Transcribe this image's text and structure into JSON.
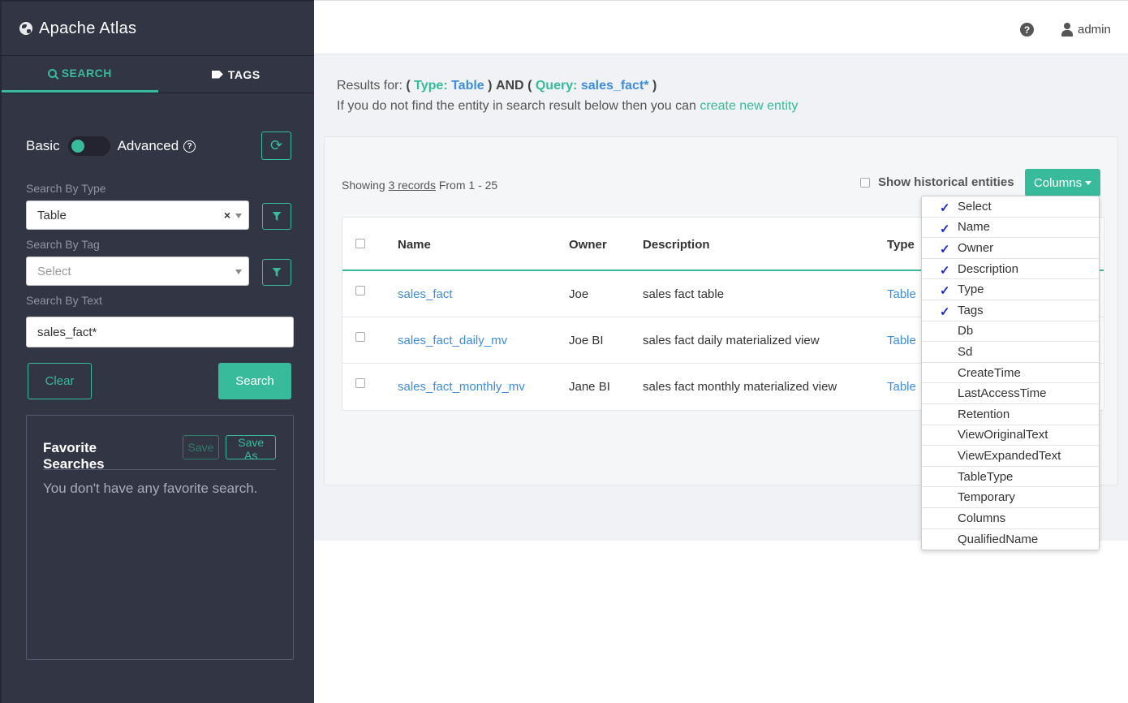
{
  "app": {
    "title": "Apache Atlas"
  },
  "sidebar": {
    "tabs": [
      {
        "label": "SEARCH",
        "active": true
      },
      {
        "label": "TAGS",
        "active": false
      }
    ],
    "toggle": {
      "basic_label": "Basic",
      "advanced_label": "Advanced",
      "advanced_help": "?"
    },
    "search_by_type": {
      "label": "Search By Type",
      "value": "Table",
      "clear": "×"
    },
    "search_by_tag": {
      "label": "Search By Tag",
      "placeholder": "Select"
    },
    "search_by_text": {
      "label": "Search By Text",
      "value": "sales_fact*"
    },
    "buttons": {
      "clear": "Clear",
      "search": "Search"
    },
    "favorites": {
      "title": "Favorite Searches",
      "save": "Save",
      "save_as": "Save As",
      "empty": "You don't have any favorite search."
    }
  },
  "header": {
    "help": "?",
    "user": "admin"
  },
  "main": {
    "results": {
      "prefix": "Results for:",
      "open1": "(",
      "type_kw": "Type:",
      "type_val": "Table",
      "close1": ")",
      "and": "AND",
      "open2": "(",
      "query_kw": "Query:",
      "query_val": "sales_fact*",
      "close2": ")"
    },
    "info": {
      "text": "If you do not find the entity in search result below then you can",
      "link": "create new entity"
    },
    "showing": {
      "prefix": "Showing",
      "count": "3 records",
      "suffix": "From 1 - 25"
    },
    "historical_label": "Show historical entities",
    "columns_button": "Columns",
    "table": {
      "headers": [
        "Name",
        "Owner",
        "Description",
        "Type"
      ],
      "rows": [
        {
          "name": "sales_fact",
          "owner": "Joe",
          "description": "sales fact table",
          "type": "Table"
        },
        {
          "name": "sales_fact_daily_mv",
          "owner": "Joe BI",
          "description": "sales fact daily materialized view",
          "type": "Table"
        },
        {
          "name": "sales_fact_monthly_mv",
          "owner": "Jane BI",
          "description": "sales fact monthly materialized view",
          "type": "Table"
        }
      ]
    },
    "columns_menu": [
      {
        "label": "Select",
        "checked": true
      },
      {
        "label": "Name",
        "checked": true
      },
      {
        "label": "Owner",
        "checked": true
      },
      {
        "label": "Description",
        "checked": true
      },
      {
        "label": "Type",
        "checked": true
      },
      {
        "label": "Tags",
        "checked": true
      },
      {
        "label": "Db",
        "checked": false
      },
      {
        "label": "Sd",
        "checked": false
      },
      {
        "label": "CreateTime",
        "checked": false
      },
      {
        "label": "LastAccessTime",
        "checked": false
      },
      {
        "label": "Retention",
        "checked": false
      },
      {
        "label": "ViewOriginalText",
        "checked": false
      },
      {
        "label": "ViewExpandedText",
        "checked": false
      },
      {
        "label": "TableType",
        "checked": false
      },
      {
        "label": "Temporary",
        "checked": false
      },
      {
        "label": "Columns",
        "checked": false
      },
      {
        "label": "QualifiedName",
        "checked": false
      }
    ],
    "check_glyph": "✓"
  },
  "colors": {
    "accent": "#38bb9b",
    "link": "#3c8dde",
    "sidebar_bg": "#323544"
  }
}
